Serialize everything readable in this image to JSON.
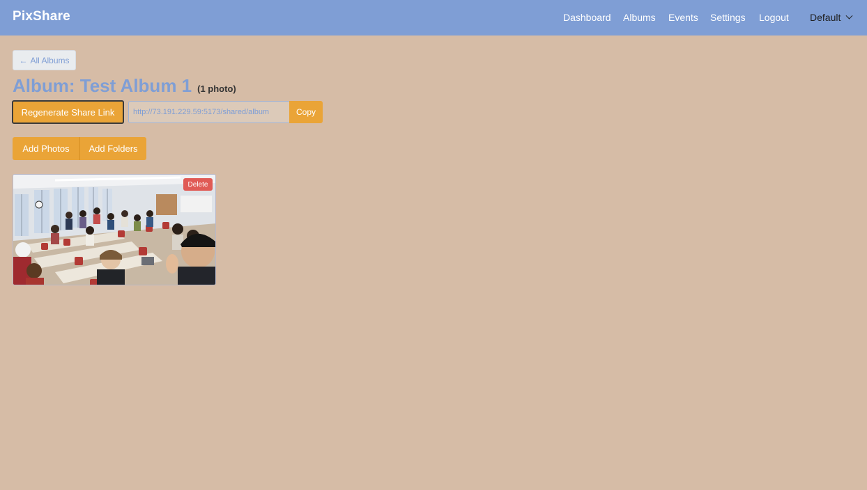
{
  "header": {
    "brand": "PixShare",
    "nav": [
      "Dashboard",
      "Albums",
      "Events",
      "Settings",
      "Logout"
    ],
    "theme_selected": "Default",
    "colors": {
      "bar": "#7f9ed5",
      "text": "#ffffff"
    }
  },
  "main": {
    "back_label": "All Albums",
    "album_title": "Album: Test Album 1",
    "photo_count": "(1 photo)",
    "regenerate_label": "Regenerate Share Link",
    "share_link": "http://73.191.229.59:5173/shared/album",
    "copy_label": "Copy",
    "add_photos_label": "Add Photos",
    "add_folders_label": "Add Folders",
    "colors": {
      "accent": "#eaa437",
      "danger": "#e05a55",
      "background": "#d6bca6"
    }
  },
  "photos": [
    {
      "delete_label": "Delete",
      "icon": "group-classroom-photo"
    }
  ]
}
